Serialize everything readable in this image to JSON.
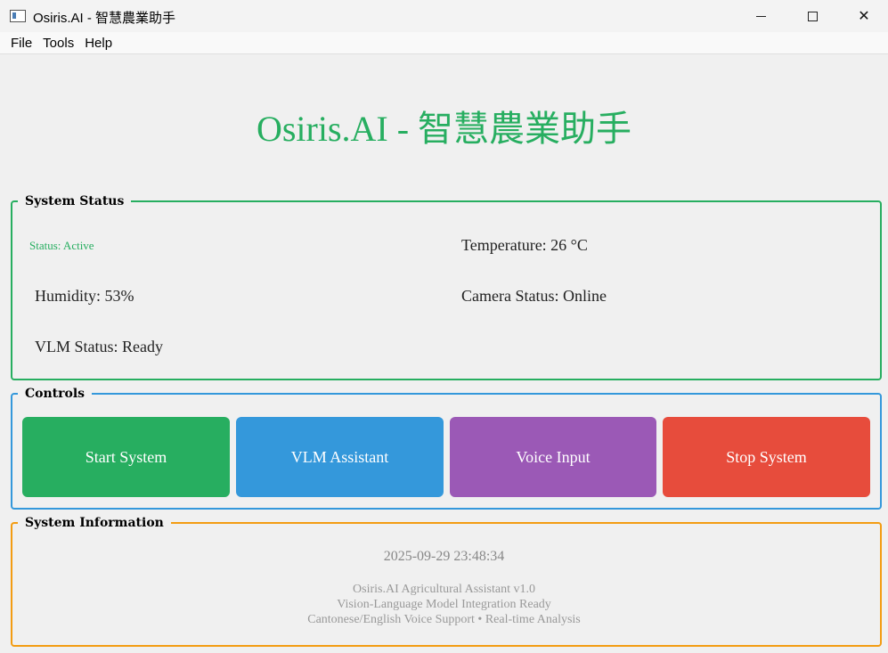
{
  "window": {
    "title": "Osiris.AI - 智慧農業助手",
    "min_glyph": "",
    "close_glyph": "✕"
  },
  "menu": [
    "File",
    "Tools",
    "Help"
  ],
  "header": {
    "title": "Osiris.AI - 智慧農業助手",
    "color": "#27ae60"
  },
  "status_panel": {
    "legend": "System Status",
    "border_color": "#27ae60",
    "status": "Status: Active",
    "temperature": "Temperature: 26 °C",
    "humidity": "Humidity: 53%",
    "camera": "Camera Status: Online",
    "vlm": "VLM Status: Ready"
  },
  "controls_panel": {
    "legend": "Controls",
    "border_color": "#3498db",
    "buttons": [
      {
        "label": "Start System",
        "color": "#27ae60"
      },
      {
        "label": "VLM Assistant",
        "color": "#3498db"
      },
      {
        "label": "Voice Input",
        "color": "#9b59b6"
      },
      {
        "label": "Stop System",
        "color": "#e74c3c"
      }
    ]
  },
  "info_panel": {
    "legend": "System Information",
    "border_color": "#f39c12",
    "datetime": "2025-09-29 23:48:34",
    "line1": "Osiris.AI Agricultural Assistant v1.0",
    "line2": "Vision-Language Model Integration Ready",
    "line3": "Cantonese/English Voice Support  •  Real-time Analysis"
  }
}
